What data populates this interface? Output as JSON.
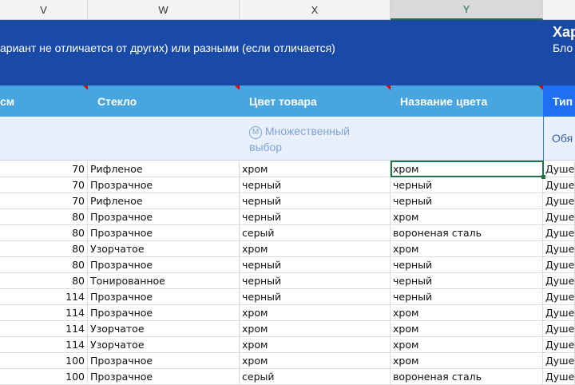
{
  "columns": [
    "V",
    "W",
    "X",
    "Y"
  ],
  "banner": {
    "text": "ариант не отличается от других) или разными (если отличается)",
    "right_title": "Хар",
    "right_sub": "Бло"
  },
  "headers": [
    "см",
    "Стекло",
    "Цвет товара",
    "Название цвета",
    "Тип"
  ],
  "subheader": {
    "multi_icon": "М",
    "multi_text": "Множественный выбор",
    "right": "Обя"
  },
  "rows": [
    [
      "70",
      "Рифленое",
      "хром",
      "хром",
      "Душе"
    ],
    [
      "70",
      "Прозрачное",
      "черный",
      "черный",
      "Душе"
    ],
    [
      "70",
      "Рифленое",
      "черный",
      "черный",
      "Душе"
    ],
    [
      "80",
      "Прозрачное",
      "черный",
      "хром",
      "Душе"
    ],
    [
      "80",
      "Прозрачное",
      "серый",
      "вороненая сталь",
      "Душе"
    ],
    [
      "80",
      "Узорчатое",
      "хром",
      "хром",
      "Душе"
    ],
    [
      "80",
      "Прозрачное",
      "черный",
      "черный",
      "Душе"
    ],
    [
      "80",
      "Тонированное",
      "черный",
      "черный",
      "Душе"
    ],
    [
      "114",
      "Прозрачное",
      "черный",
      "черный",
      "Душе"
    ],
    [
      "114",
      "Прозрачное",
      "хром",
      "хром",
      "Душе"
    ],
    [
      "114",
      "Узорчатое",
      "хром",
      "хром",
      "Душе"
    ],
    [
      "114",
      "Узорчатое",
      "хром",
      "хром",
      "Душе"
    ],
    [
      "100",
      "Прозрачное",
      "хром",
      "хром",
      "Душе"
    ],
    [
      "100",
      "Прозрачное",
      "серый",
      "вороненая сталь",
      "Душе"
    ]
  ]
}
